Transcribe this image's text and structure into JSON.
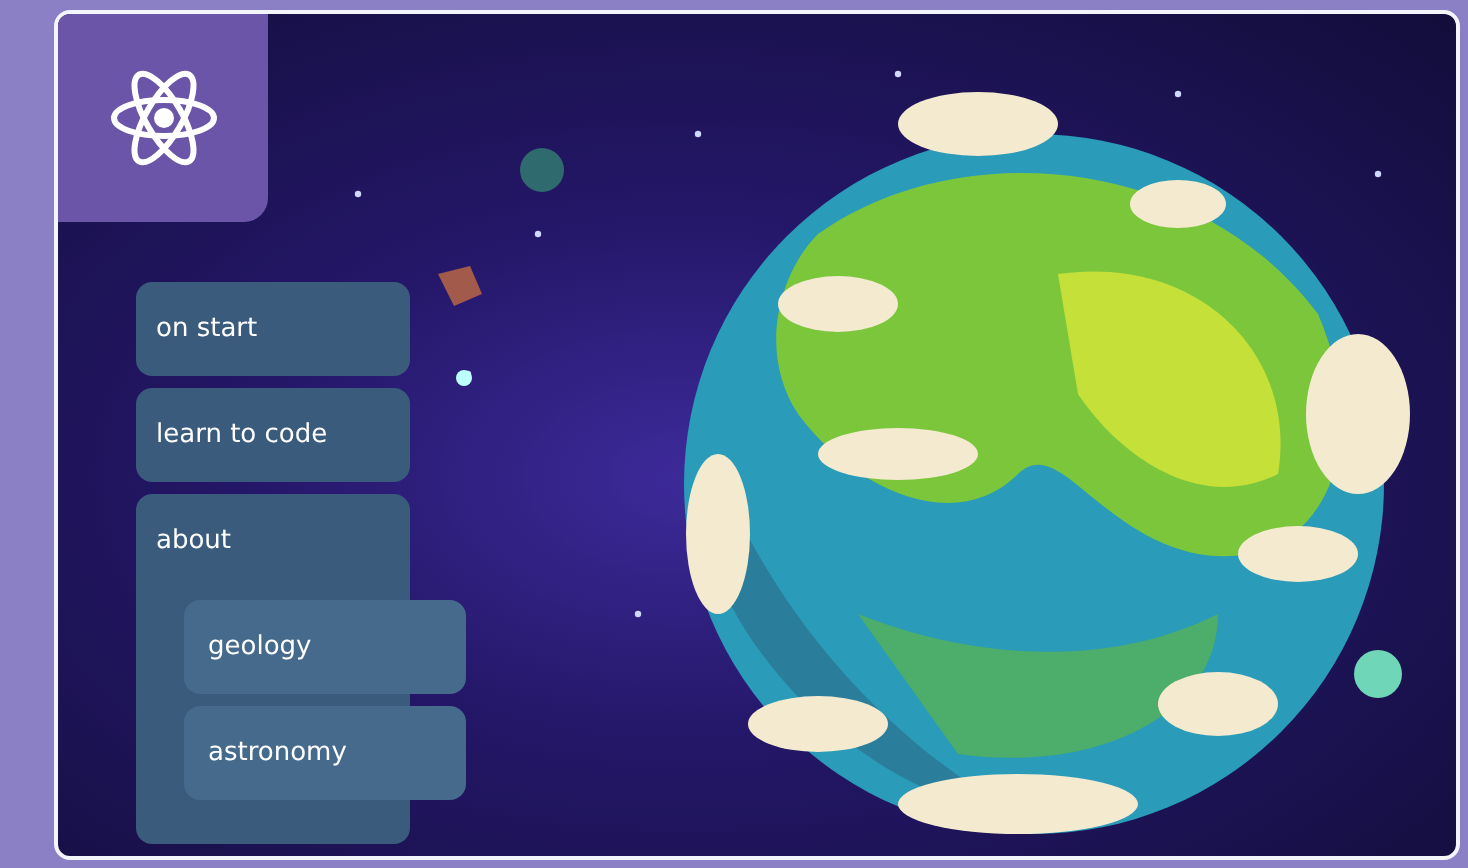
{
  "blocks": [
    {
      "label": "on start"
    },
    {
      "label": "learn to code"
    },
    {
      "label": "about",
      "children": [
        {
          "label": "geology"
        },
        {
          "label": "astronomy"
        }
      ]
    }
  ]
}
